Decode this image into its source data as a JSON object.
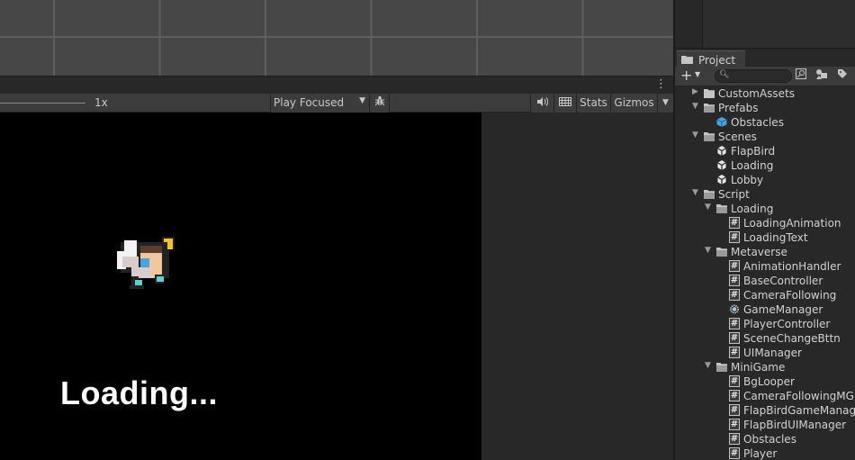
{
  "game_toolbar": {
    "scale_value": "1x",
    "play_mode": "Play Focused",
    "stats_label": "Stats",
    "gizmos_label": "Gizmos",
    "menu_glyph": "⋮",
    "speaker_icon": "speaker-icon",
    "bug_icon": "bug-icon"
  },
  "game_view": {
    "loading_text": "Loading..."
  },
  "project": {
    "tab_label": "Project",
    "search_placeholder": "",
    "tree": [
      {
        "label": "CustomAssets",
        "kind": "folder",
        "expanded": false
      },
      {
        "label": "Prefabs",
        "kind": "folder",
        "expanded": true
      },
      {
        "label": "Obstacles",
        "kind": "prefab"
      },
      {
        "label": "Scenes",
        "kind": "folder",
        "expanded": true
      },
      {
        "label": "FlapBird",
        "kind": "scene"
      },
      {
        "label": "Loading",
        "kind": "scene"
      },
      {
        "label": "Lobby",
        "kind": "scene"
      },
      {
        "label": "Script",
        "kind": "folder",
        "expanded": true
      },
      {
        "label": "Loading",
        "kind": "folder",
        "expanded": true
      },
      {
        "label": "LoadingAnimation",
        "kind": "script"
      },
      {
        "label": "LoadingText",
        "kind": "script"
      },
      {
        "label": "Metaverse",
        "kind": "folder",
        "expanded": true
      },
      {
        "label": "AnimationHandler",
        "kind": "script"
      },
      {
        "label": "BaseController",
        "kind": "script"
      },
      {
        "label": "CameraFollowing",
        "kind": "script"
      },
      {
        "label": "GameManager",
        "kind": "gear"
      },
      {
        "label": "PlayerController",
        "kind": "script"
      },
      {
        "label": "SceneChangeBttn",
        "kind": "script"
      },
      {
        "label": "UIManager",
        "kind": "script"
      },
      {
        "label": "MiniGame",
        "kind": "folder",
        "expanded": true
      },
      {
        "label": "BgLooper",
        "kind": "script"
      },
      {
        "label": "CameraFollowingMG",
        "kind": "script"
      },
      {
        "label": "FlapBirdGameManage",
        "kind": "script"
      },
      {
        "label": "FlapBirdUIManager",
        "kind": "script"
      },
      {
        "label": "Obstacles",
        "kind": "script"
      },
      {
        "label": "Player",
        "kind": "script"
      }
    ]
  },
  "colors": {
    "editor_bg": "#282828",
    "toolbar_bg": "#3c3c3c",
    "scene_bg": "#474747",
    "game_bg": "#000000",
    "prefab_blue": "#4aa3df"
  }
}
